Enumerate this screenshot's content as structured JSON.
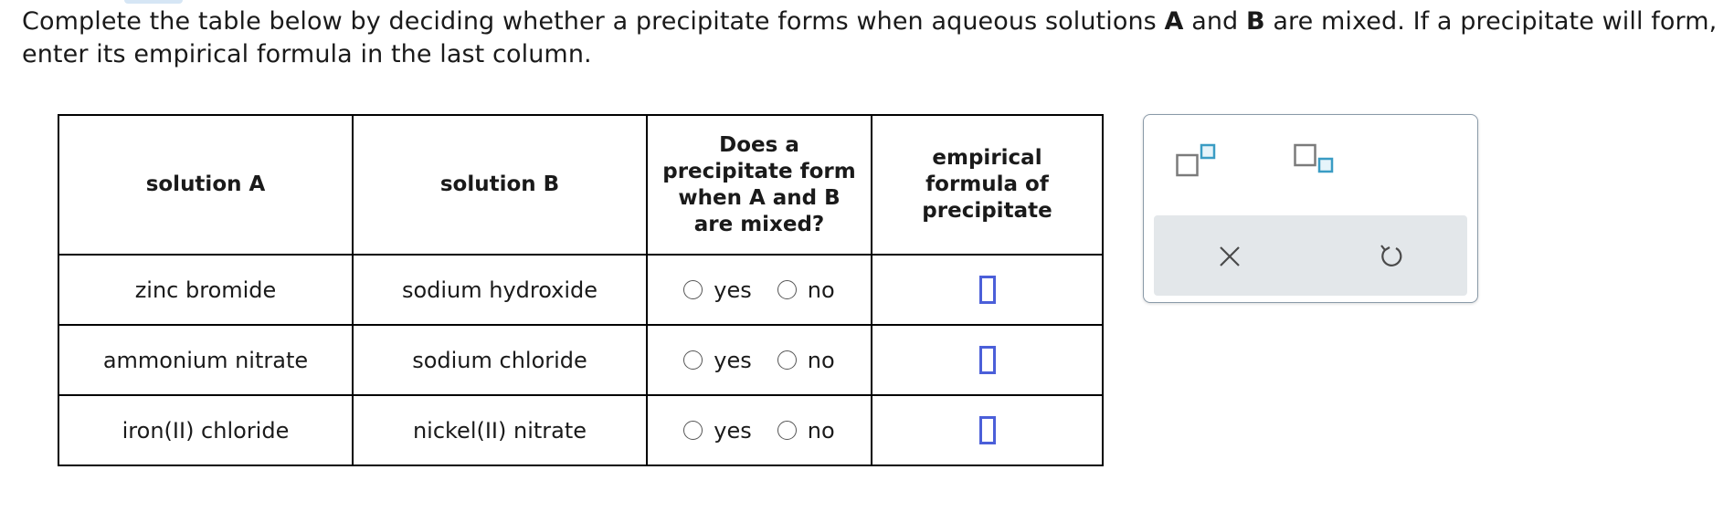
{
  "prompt": {
    "part1": "Complete the table below by deciding whether a precipitate forms when aqueous solutions ",
    "bold_a": "A",
    "part2": " and ",
    "bold_b": "B",
    "part3": " are mixed. If a precipitate will form, enter its empirical formula in the last column."
  },
  "table": {
    "headers": {
      "solution_a": "solution A",
      "solution_b": "solution B",
      "precipitate": "Does a precipitate form when A and B are mixed?",
      "formula": "empirical formula of precipitate"
    },
    "rows": [
      {
        "solution_a": "zinc bromide",
        "solution_b": "sodium hydroxide",
        "yes_label": "yes",
        "no_label": "no",
        "formula": ""
      },
      {
        "solution_a": "ammonium nitrate",
        "solution_b": "sodium chloride",
        "yes_label": "yes",
        "no_label": "no",
        "formula": ""
      },
      {
        "solution_a": "iron(II) chloride",
        "solution_b": "nickel(II) nitrate",
        "yes_label": "yes",
        "no_label": "no",
        "formula": ""
      }
    ]
  },
  "tools": {
    "icons": [
      "superscript-icon",
      "subscript-icon",
      "clear-icon",
      "undo-icon"
    ]
  },
  "colors": {
    "answer_box": "#4b5fd9",
    "tool_accent": "#3a9cc4",
    "tool_bg": "#e3e7ea"
  }
}
